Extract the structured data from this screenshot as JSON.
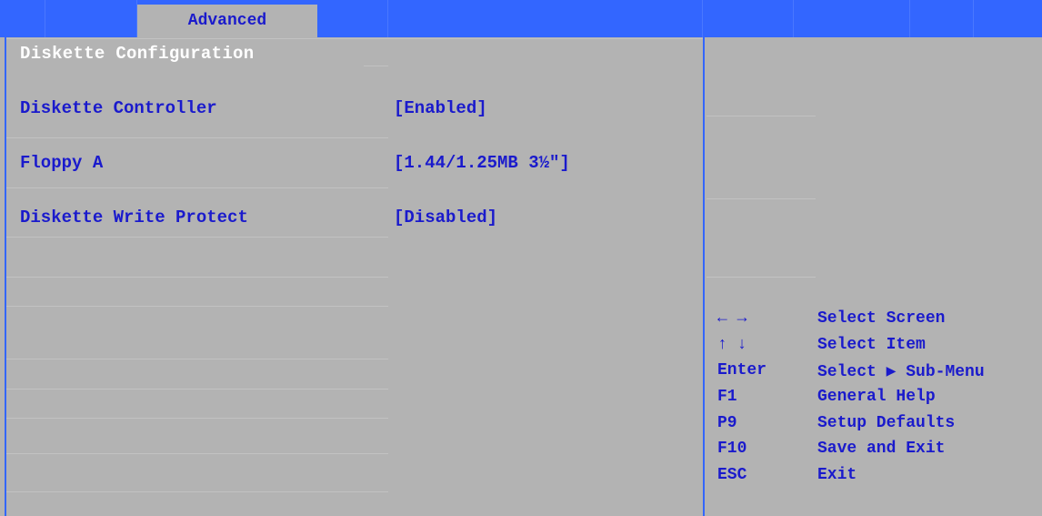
{
  "menubar": {
    "active_tab": "Advanced"
  },
  "section": {
    "title": "Diskette Configuration"
  },
  "settings": [
    {
      "label": "Diskette Controller",
      "value": "[Enabled]"
    },
    {
      "label": "Floppy A",
      "value": "[1.44/1.25MB 3½\"]"
    },
    {
      "label": "Diskette Write Protect",
      "value": "[Disabled]"
    }
  ],
  "help": [
    {
      "key": "← →",
      "desc": "Select Screen"
    },
    {
      "key": "↑ ↓",
      "desc": "Select Item"
    },
    {
      "key": "Enter",
      "desc": "Select ▶ Sub-Menu"
    },
    {
      "key": "F1",
      "desc": "General Help"
    },
    {
      "key": "P9",
      "desc": "Setup Defaults"
    },
    {
      "key": "F10",
      "desc": "Save and Exit"
    },
    {
      "key": "ESC",
      "desc": "Exit"
    }
  ],
  "colors": {
    "bar_blue": "#3366ff",
    "panel_gray": "#b3b3b3",
    "text_blue": "#1a1acc",
    "title_white": "#ffffff"
  }
}
